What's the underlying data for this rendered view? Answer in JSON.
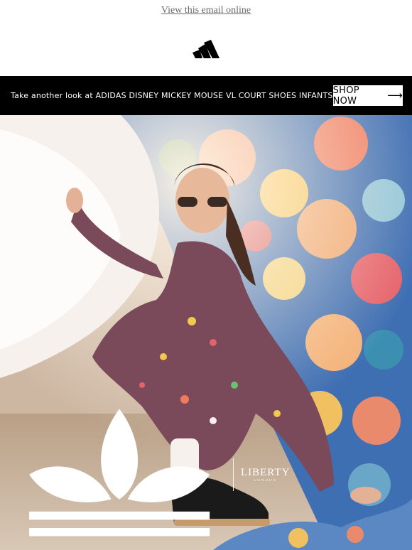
{
  "header": {
    "view_online": "View this email online",
    "logo_icon": "adidas-performance-logo-icon"
  },
  "promo": {
    "text": "Take another look at ADIDAS DISNEY MICKEY MOUSE VL COURT SHOES INFANTS",
    "button_label": "SHOP NOW",
    "button_icon": "arrow-right-icon"
  },
  "hero": {
    "image_icon": "hero-photo",
    "brand_icon": "adidas-trefoil-icon",
    "partner_name": "LIBERTY",
    "partner_sub": "LONDON"
  },
  "colors": {
    "bar": "#000000",
    "link": "#6b6b6b"
  }
}
